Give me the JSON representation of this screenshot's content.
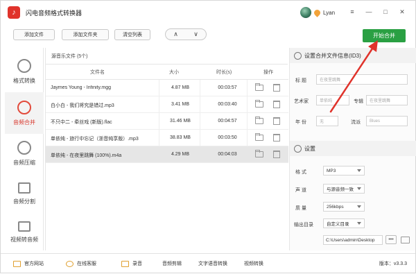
{
  "window": {
    "title": "闪电音频格式转换器",
    "logo_glyph": "♪",
    "user_name": "Lyan",
    "controls": [
      "≡",
      "—",
      "□",
      "✕"
    ]
  },
  "toolbar": {
    "add_file": "添加文件",
    "add_folder": "添加文件夹",
    "clear_list": "清空列表",
    "move_up": "∧",
    "move_down": "∨",
    "start_merge": "开始合并"
  },
  "sidebar": {
    "items": [
      {
        "label": "格式转换",
        "icon": "refresh-icon",
        "active": false
      },
      {
        "label": "音频合并",
        "icon": "merge-icon",
        "active": true
      },
      {
        "label": "音频压缩",
        "icon": "compress-icon",
        "active": false
      },
      {
        "label": "音频分割",
        "icon": "split-icon",
        "active": false
      },
      {
        "label": "视频转音频",
        "icon": "video-icon",
        "active": false
      }
    ]
  },
  "file_list": {
    "header": "源音乐文件 (5个)",
    "columns": {
      "name": "文件名",
      "size": "大小",
      "duration": "时长(s)",
      "actions": "操作"
    },
    "rows": [
      {
        "name": "Jaymes Young - Infinity.mgg",
        "size": "4.87 MB",
        "duration": "00:03:57"
      },
      {
        "name": "白小白 - 我们将究是错过.mp3",
        "size": "3.41 MB",
        "duration": "00:03:40"
      },
      {
        "name": "不只中二 - 牵丝戏 (新版).flac",
        "size": "31.46 MB",
        "duration": "00:04:57"
      },
      {
        "name": "单依纯 - 旅行中忘记（浙音纯享版）.mp3",
        "size": "38.83 MB",
        "duration": "00:03:50"
      },
      {
        "name": "单依纯 - 在夜里跳舞 (100%).m4a",
        "size": "4.29 MB",
        "duration": "00:04:03"
      }
    ]
  },
  "info_panel": {
    "title": "设置合并文件信息(ID3)",
    "fields": {
      "title_label": "标    题",
      "title_placeholder": "在夜里跳舞",
      "artist_label": "艺术家",
      "artist_placeholder": "单依纯",
      "album_label": "专辑",
      "album_placeholder": "在夜里跳舞",
      "year_label": "年    份",
      "year_placeholder": "无",
      "genre_label": "流派",
      "genre_placeholder": "Blues"
    }
  },
  "settings_panel": {
    "title": "设置",
    "format_label": "格    式",
    "format_value": "MP3",
    "channel_label": "声    道",
    "channel_value": "与源音频一致",
    "quality_label": "质    量",
    "quality_value": "256kbps",
    "output_label": "输出目录",
    "output_value": "自定义目录",
    "output_path": "C:\\Users\\admin\\Desktop",
    "more_label": "•••"
  },
  "bottom": {
    "website": "官方网站",
    "service": "在线客服",
    "record": "录音",
    "audio_cut": "音频剪辑",
    "tts": "文字语音转换",
    "video_convert": "视频转换",
    "version": "版本：v3.3.3"
  },
  "colors": {
    "accent_green": "#2aa043",
    "active_red": "#d83a2f",
    "annotation_red": "#e0332b"
  }
}
